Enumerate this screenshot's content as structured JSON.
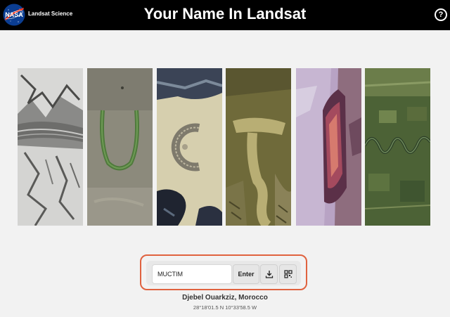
{
  "header": {
    "brand_label": "Landsat Science",
    "title": "Your Name In Landsat",
    "help_icon": "help-circle-icon",
    "help_glyph": "?"
  },
  "name_input": {
    "value": "MUCTIM"
  },
  "controls": {
    "enter_label": "Enter",
    "download_icon": "download-icon",
    "qr_icon": "qr-code-icon"
  },
  "location": {
    "name": "Djebel Ouarkziz, Morocco",
    "coordinates": "28°18'01.5 N 10°33'58.5 W"
  },
  "colors": {
    "header_bg": "#000000",
    "page_bg": "#f2f2f2",
    "accent_border": "#e0623f"
  }
}
